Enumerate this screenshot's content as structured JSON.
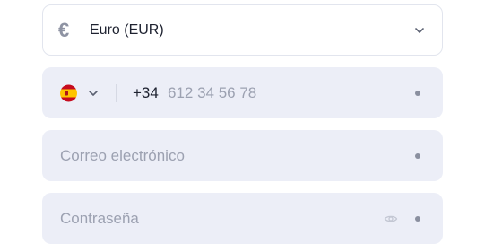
{
  "currency": {
    "icon": "euro-icon",
    "symbol": "€",
    "selected_label": "Euro (EUR)"
  },
  "phone": {
    "country_flag": "spain-flag-icon",
    "prefix": "+34",
    "placeholder": "612 34 56 78"
  },
  "email": {
    "placeholder": "Correo electrónico"
  },
  "password": {
    "placeholder": "Contraseña",
    "toggle_icon": "eye-icon"
  },
  "colors": {
    "field_bg": "#eceef7",
    "placeholder": "#9ca1b1",
    "text": "#1e2230",
    "required_dot": "#8a8f9f"
  }
}
